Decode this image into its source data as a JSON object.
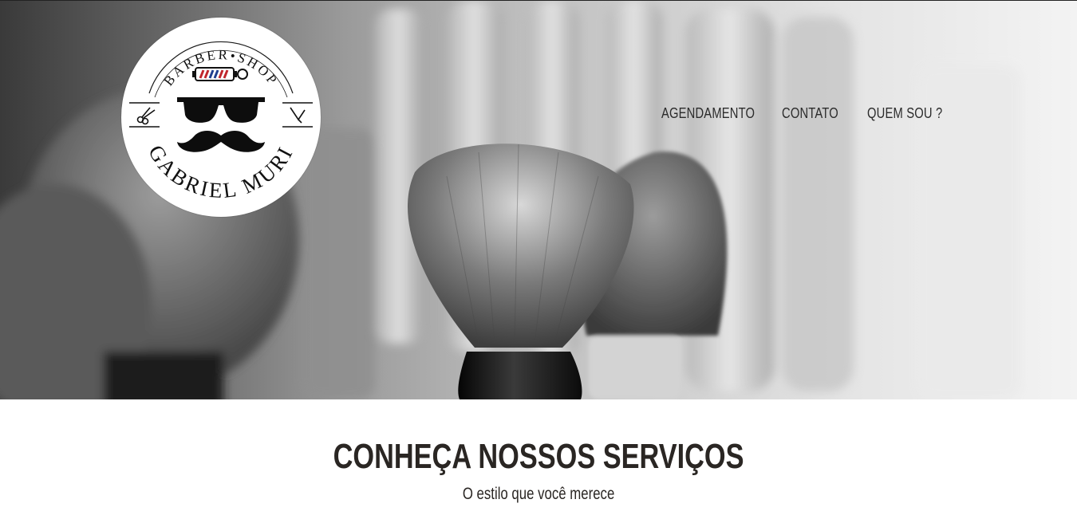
{
  "brand": {
    "top_text": "BARBER•SHOP",
    "name": "GABRIEL MURI"
  },
  "nav": {
    "items": [
      {
        "label": "AGENDAMENTO"
      },
      {
        "label": "CONTATO"
      },
      {
        "label": "QUEM SOU ?"
      }
    ]
  },
  "services": {
    "title": "CONHEÇA NOSSOS SERVIÇOS",
    "subtitle": "O estilo que você merece"
  },
  "colors": {
    "text_dark": "#2a2623",
    "nav_text": "#2b2b2b",
    "pole_red": "#c0262c",
    "pole_blue": "#1f3f8f"
  },
  "icons": [
    "barber-pole-icon",
    "sunglasses-icon",
    "mustache-icon",
    "scissors-icon",
    "razor-icon"
  ]
}
